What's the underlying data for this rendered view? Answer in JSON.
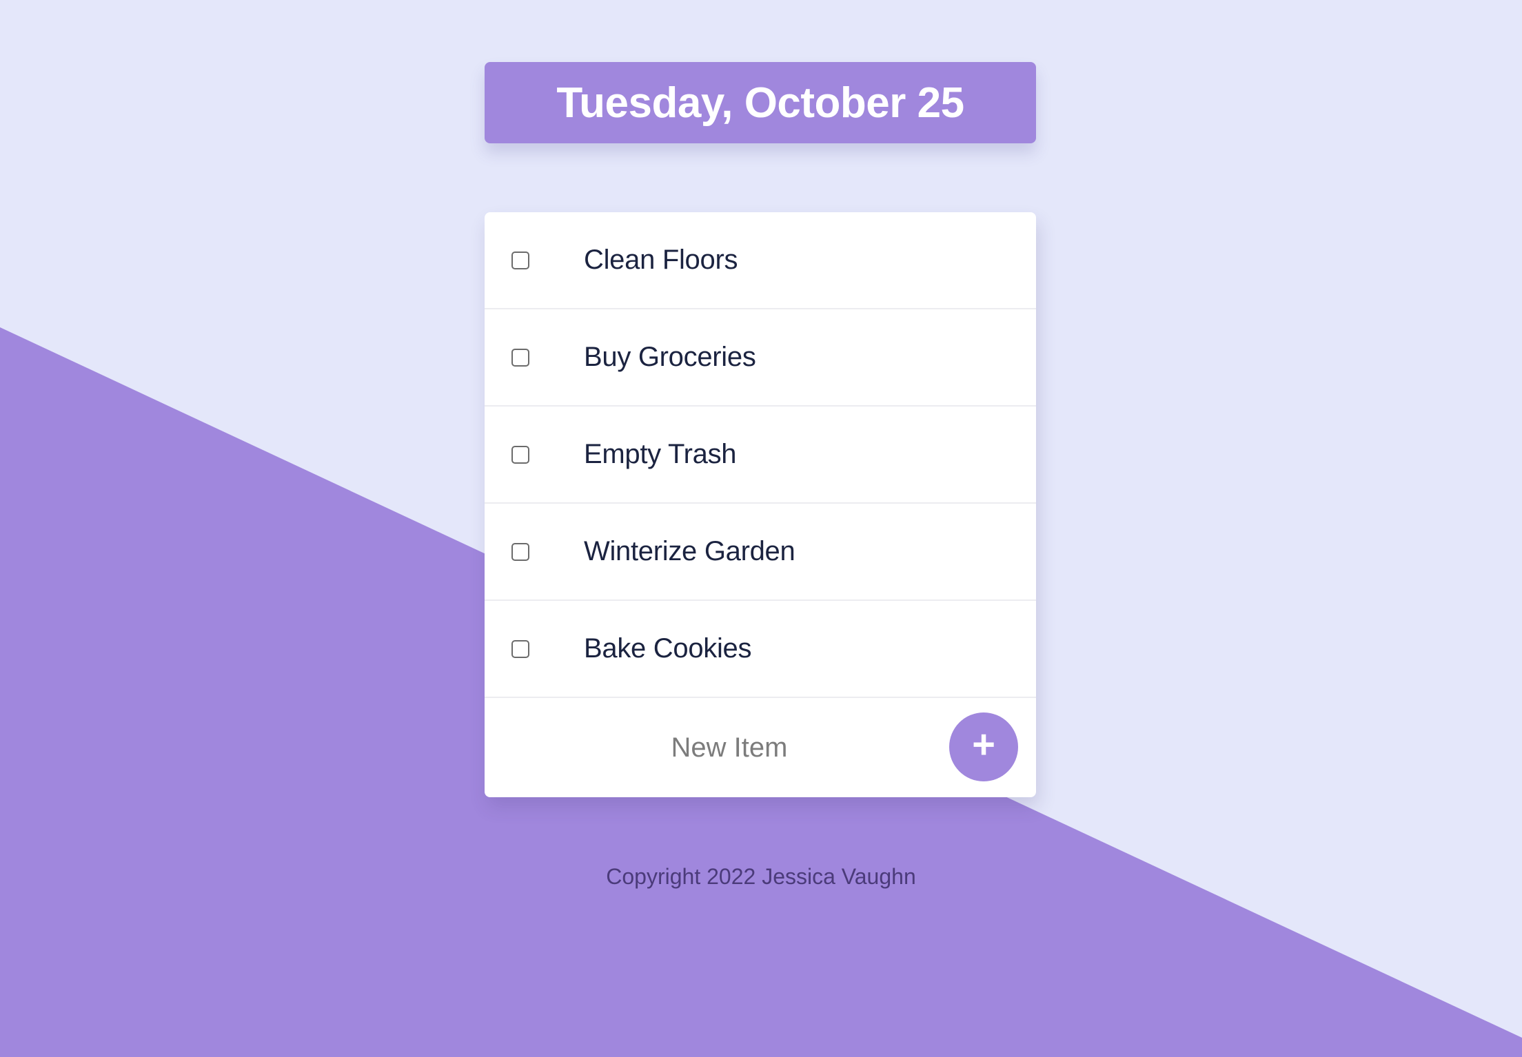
{
  "header": {
    "date": "Tuesday, October 25"
  },
  "todo": {
    "items": [
      {
        "label": "Clean Floors",
        "checked": false
      },
      {
        "label": "Buy Groceries",
        "checked": false
      },
      {
        "label": "Empty Trash",
        "checked": false
      },
      {
        "label": "Winterize Garden",
        "checked": false
      },
      {
        "label": "Bake Cookies",
        "checked": false
      }
    ],
    "new_item_placeholder": "New Item",
    "add_button_label": "+"
  },
  "footer": {
    "copyright": "Copyright 2022 Jessica Vaughn"
  },
  "colors": {
    "background": "#e4e7fa",
    "accent": "#a087dd",
    "card": "#ffffff",
    "text": "#1b2340"
  },
  "icons": {
    "add": "plus-icon"
  }
}
